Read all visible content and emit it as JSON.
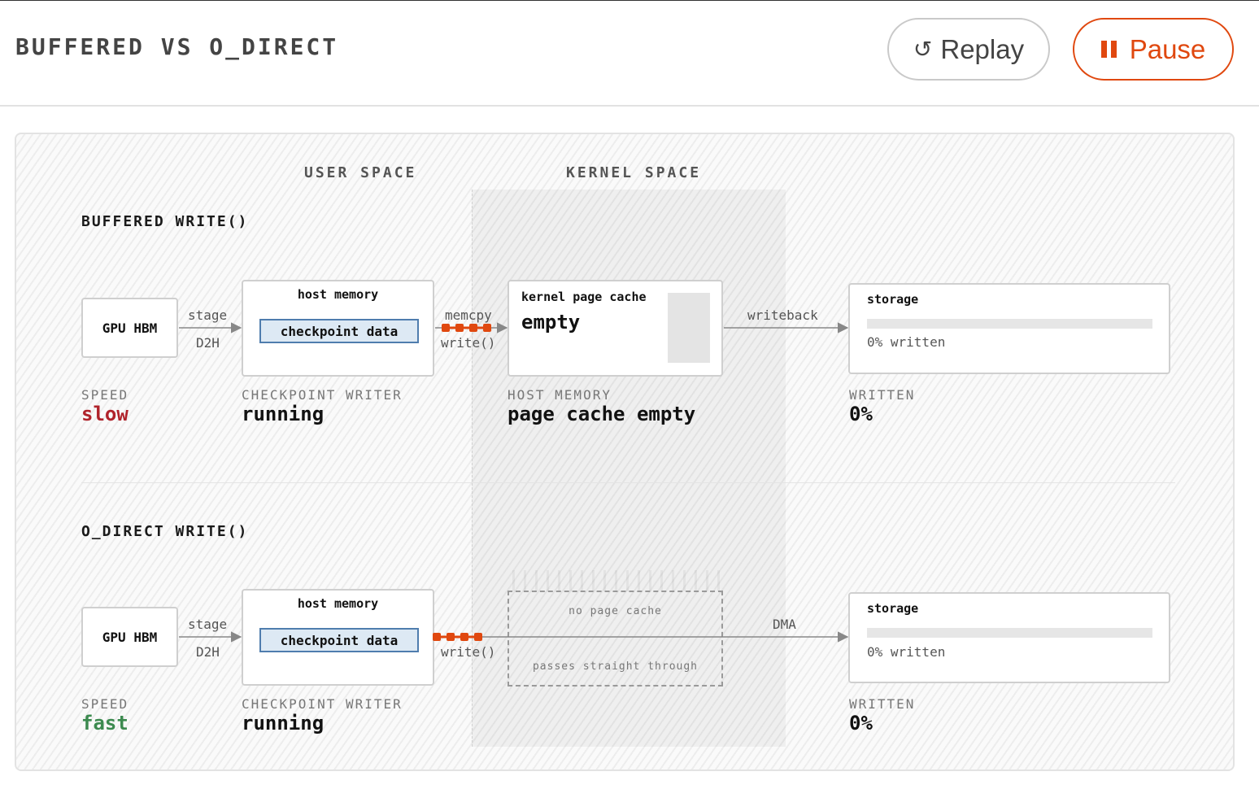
{
  "header": {
    "title": "BUFFERED VS O_DIRECT",
    "replay_label": "Replay",
    "replay_icon": "replay-icon",
    "pause_label": "Pause",
    "pause_icon": "pause-icon",
    "accent_color": "#e0480f"
  },
  "diagram": {
    "space_labels": {
      "user": "USER SPACE",
      "kernel": "KERNEL SPACE"
    },
    "buffered": {
      "title": "BUFFERED WRITE()",
      "gpu_label": "GPU HBM",
      "stage_top": "stage",
      "stage_bottom": "D2H",
      "host_title": "host memory",
      "checkpoint_label": "checkpoint data",
      "link_top": "memcpy",
      "link_bottom": "write()",
      "cache_title": "kernel page cache",
      "cache_value": "empty",
      "writeback_label": "writeback",
      "storage_title": "storage",
      "storage_progress": 0,
      "storage_written": "0% written",
      "speed_label": "SPEED",
      "speed_value": "slow",
      "writer_label": "CHECKPOINT WRITER",
      "writer_value": "running",
      "host_mem_label": "HOST MEMORY",
      "host_mem_value": "page cache empty",
      "written_label": "WRITTEN",
      "written_value": "0%",
      "speed_color": "#b0232b"
    },
    "direct": {
      "title": "O_DIRECT WRITE()",
      "gpu_label": "GPU HBM",
      "stage_top": "stage",
      "stage_bottom": "D2H",
      "host_title": "host memory",
      "checkpoint_label": "checkpoint data",
      "link_bottom": "write()",
      "no_cache_label": "no page cache",
      "passes_label": "passes straight through",
      "dma_label": "DMA",
      "storage_title": "storage",
      "storage_progress": 0,
      "storage_written": "0% written",
      "speed_label": "SPEED",
      "speed_value": "fast",
      "writer_label": "CHECKPOINT WRITER",
      "writer_value": "running",
      "written_label": "WRITTEN",
      "written_value": "0%",
      "speed_color": "#3c8a4f"
    },
    "packet_color": "#e0480f",
    "packets_in_flight": 4
  }
}
